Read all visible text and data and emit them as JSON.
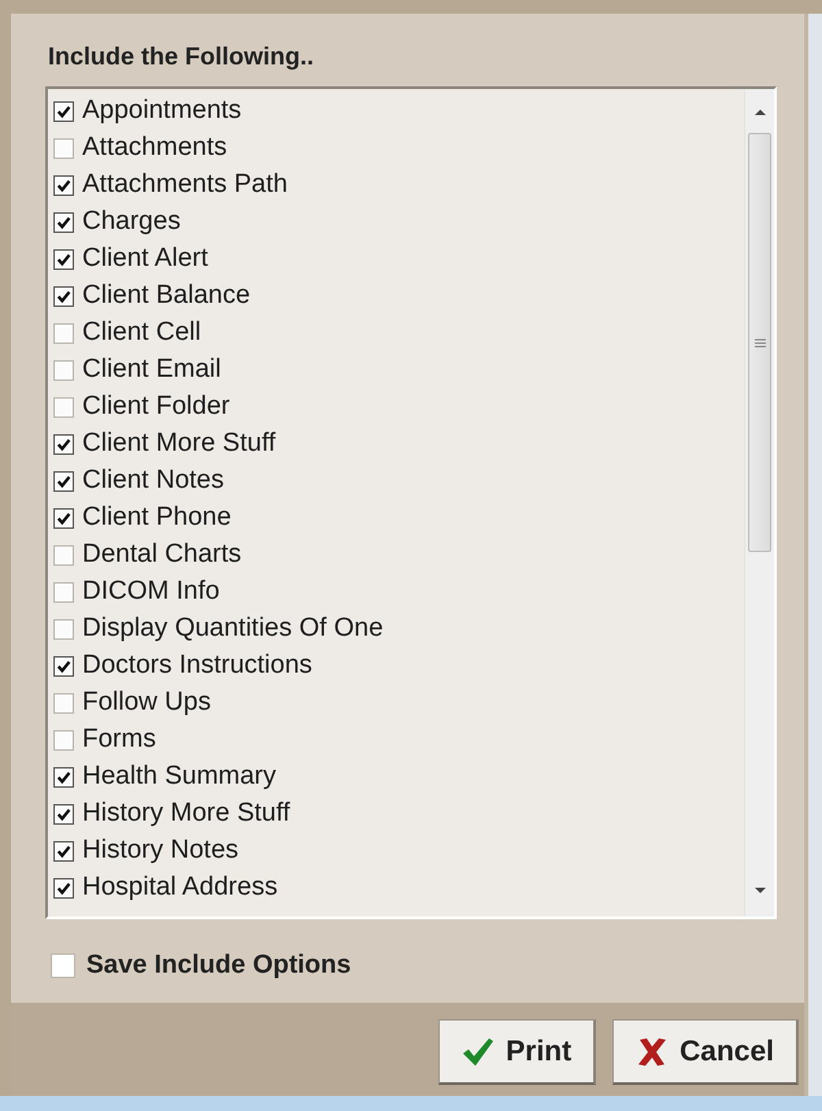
{
  "section": {
    "title": "Include the Following.."
  },
  "items": [
    {
      "label": "Appointments",
      "checked": true
    },
    {
      "label": "Attachments",
      "checked": false
    },
    {
      "label": "Attachments Path",
      "checked": true
    },
    {
      "label": "Charges",
      "checked": true
    },
    {
      "label": "Client Alert",
      "checked": true
    },
    {
      "label": "Client Balance",
      "checked": true
    },
    {
      "label": "Client Cell",
      "checked": false
    },
    {
      "label": "Client Email",
      "checked": false
    },
    {
      "label": "Client Folder",
      "checked": false
    },
    {
      "label": "Client More Stuff",
      "checked": true
    },
    {
      "label": "Client Notes",
      "checked": true
    },
    {
      "label": "Client Phone",
      "checked": true
    },
    {
      "label": "Dental Charts",
      "checked": false
    },
    {
      "label": "DICOM Info",
      "checked": false
    },
    {
      "label": "Display Quantities Of One",
      "checked": false
    },
    {
      "label": "Doctors Instructions",
      "checked": true
    },
    {
      "label": "Follow Ups",
      "checked": false
    },
    {
      "label": "Forms",
      "checked": false
    },
    {
      "label": "Health Summary",
      "checked": true
    },
    {
      "label": "History More Stuff",
      "checked": true
    },
    {
      "label": "History Notes",
      "checked": true
    },
    {
      "label": "Hospital Address",
      "checked": true
    }
  ],
  "save_option": {
    "label": "Save Include Options",
    "checked": false
  },
  "buttons": [
    {
      "label": "Print",
      "kind": "ok"
    },
    {
      "label": "Cancel",
      "kind": "cancel"
    }
  ]
}
